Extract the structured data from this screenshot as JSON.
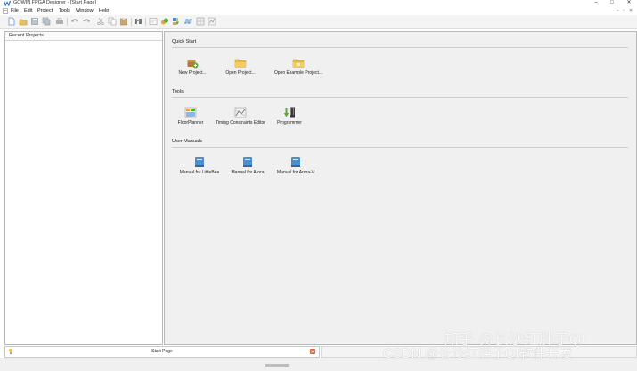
{
  "window": {
    "title": "GOWIN FPGA Designer - [Start Page]",
    "controls": {
      "minimize": "–",
      "maximize": "□",
      "close": "✕"
    }
  },
  "menu": {
    "items": [
      "File",
      "Edit",
      "Project",
      "Tools",
      "Window",
      "Help"
    ],
    "mdi_controls": {
      "minimize": "–",
      "restore": "▫",
      "close": "✕"
    }
  },
  "toolbar": {
    "icons": [
      "new-file-icon",
      "open-folder-icon",
      "save-icon",
      "save-all-icon",
      "print-icon",
      "undo-icon",
      "redo-icon",
      "cut-icon",
      "copy-icon",
      "paste-icon",
      "find-icon",
      "synthesize-icon",
      "place-route-icon",
      "program-device-icon",
      "timing-icon",
      "floorplan-icon",
      "report-icon"
    ]
  },
  "recent_projects": {
    "title": "Recent Projects"
  },
  "start_page": {
    "sections": [
      {
        "title": "Quick Start",
        "items": [
          {
            "label": "New Project..."
          },
          {
            "label": "Open Project..."
          },
          {
            "label": "Open Example Project..."
          }
        ]
      },
      {
        "title": "Tools",
        "items": [
          {
            "label": "FloorPlanner"
          },
          {
            "label": "Timing Constraints Editor"
          },
          {
            "label": "Programmer"
          }
        ]
      },
      {
        "title": "User Manuals",
        "items": [
          {
            "label": "Manual for LittleBee"
          },
          {
            "label": "Manual for Arora"
          },
          {
            "label": "Manual for Arora-V"
          }
        ]
      }
    ]
  },
  "bottom_tabs": {
    "start_page_label": "Start Page"
  },
  "watermarks": {
    "line1": "知乎 @长沙红胖子Qt",
    "line2": "CSDN @长沙红胖子Qt软件开发"
  },
  "colors": {
    "accent_green": "#5aa832",
    "folder_yellow": "#e8b840",
    "manual_blue": "#4a90d0",
    "close_red": "#e06040"
  }
}
